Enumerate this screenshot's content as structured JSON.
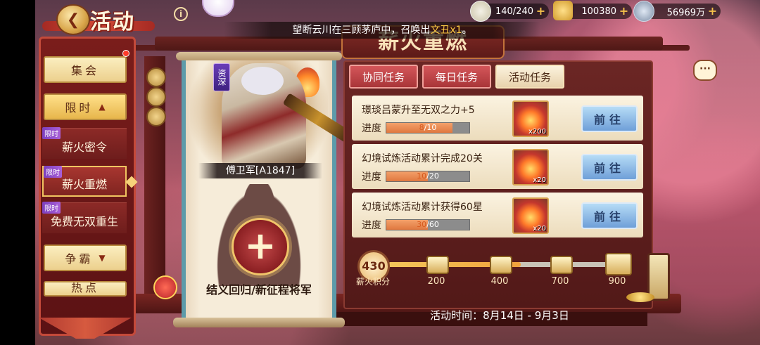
{
  "header": {
    "title": "活动",
    "resources": [
      {
        "icon": "jade-icon",
        "value": "140/240"
      },
      {
        "icon": "gold-ingot-icon",
        "value": "100380"
      },
      {
        "icon": "coin-icon",
        "value": "56969万"
      }
    ],
    "notice_prefix": "望断云川在三顾茅庐中，召唤出",
    "notice_highlight": "文丑x1",
    "notice_suffix": "。"
  },
  "sidebar": {
    "categories": [
      {
        "label": "集会"
      },
      {
        "label": "限时"
      },
      {
        "label": "争霸"
      },
      {
        "label": "热点"
      }
    ],
    "sub_items": [
      {
        "tag": "限时",
        "label": "薪火密令"
      },
      {
        "tag": "限时",
        "label": "薪火重燃"
      },
      {
        "tag": "限时",
        "label": "免费无双重生"
      }
    ]
  },
  "event": {
    "banner": "薪火重燃",
    "hero_badge": "资深",
    "hero_name": "傅卫军[A1847]",
    "recruit_label": "结义回归/新征程将军",
    "tabs": [
      "协同任务",
      "每日任务",
      "活动任务"
    ],
    "active_tab": "活动任务",
    "progress_label": "进度",
    "go_label": "前往",
    "tasks": [
      {
        "title": "璟琰吕蒙升至无双之力+5",
        "current": "8",
        "total": "10",
        "progress": 0.8,
        "reward_count": "x200"
      },
      {
        "title": "幻境试炼活动累计完成20关",
        "current": "10",
        "total": "20",
        "progress": 0.5,
        "reward_count": "x20"
      },
      {
        "title": "幻境试炼活动累计获得60星",
        "current": "30",
        "total": "60",
        "progress": 0.5,
        "reward_count": "x20"
      }
    ],
    "score_value": "430",
    "score_label": "薪火积分",
    "milestones": [
      "200",
      "400",
      "700",
      "900"
    ],
    "time_text": "活动时间：8月14日 - 9月3日"
  }
}
